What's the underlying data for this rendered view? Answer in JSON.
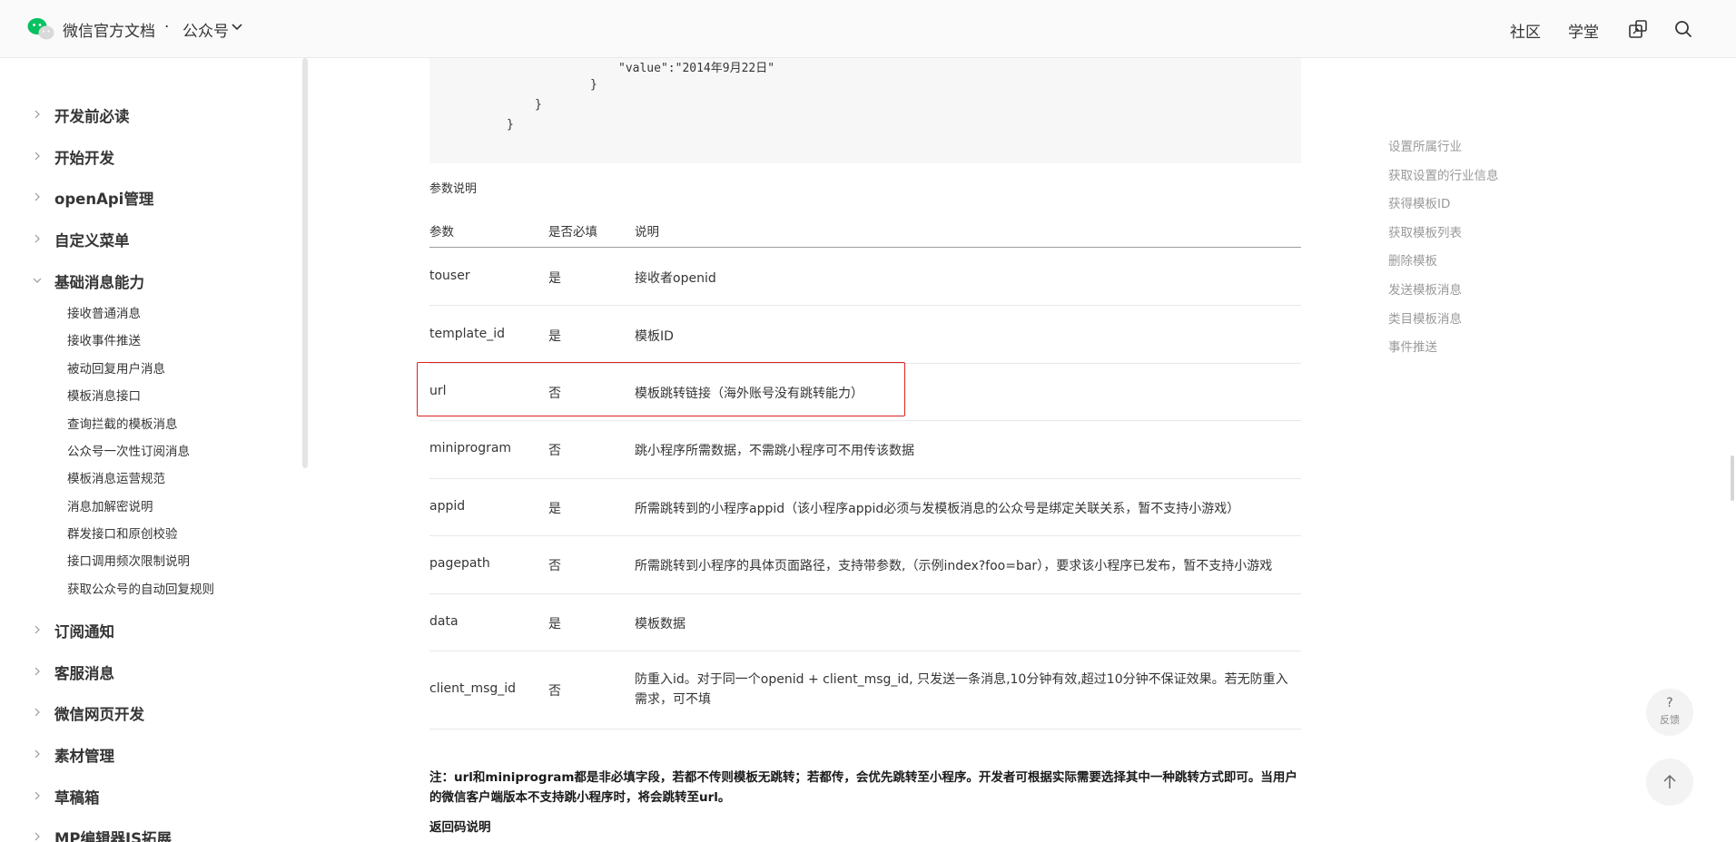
{
  "header": {
    "site_title": "微信官方文档",
    "separator": "·",
    "product": "公众号",
    "nav": [
      "社区",
      "学堂"
    ],
    "icons": {
      "logo": "wechat-logo-icon",
      "switch": "switch-view-icon",
      "search": "search-icon"
    }
  },
  "sidebar": {
    "groups_top": [
      {
        "label": "开发前必读",
        "state": "collapsed"
      },
      {
        "label": "开始开发",
        "state": "collapsed"
      },
      {
        "label": "openApi管理",
        "state": "collapsed"
      },
      {
        "label": "自定义菜单",
        "state": "collapsed"
      },
      {
        "label": "基础消息能力",
        "state": "expanded"
      }
    ],
    "sub_items": [
      "接收普通消息",
      "接收事件推送",
      "被动回复用户消息",
      "模板消息接口",
      "查询拦截的模板消息",
      "公众号一次性订阅消息",
      "模板消息运营规范",
      "消息加解密说明",
      "群发接口和原创校验",
      "接口调用频次限制说明",
      "获取公众号的自动回复规则"
    ],
    "groups_bottom": [
      {
        "label": "订阅通知",
        "state": "collapsed"
      },
      {
        "label": "客服消息",
        "state": "collapsed"
      },
      {
        "label": "微信网页开发",
        "state": "collapsed"
      },
      {
        "label": "素材管理",
        "state": "collapsed"
      },
      {
        "label": "草稿箱",
        "state": "collapsed"
      },
      {
        "label": "MP编辑器JS拓展",
        "state": "collapsed"
      }
    ]
  },
  "main": {
    "code_lines": [
      "\"value\":\"2014年9月22日\"",
      "}",
      "}",
      "}"
    ],
    "params_title": "参数说明",
    "table_headers": [
      "参数",
      "是否必填",
      "说明"
    ],
    "table_rows": [
      {
        "param": "touser",
        "required": "是",
        "desc": "接收者openid"
      },
      {
        "param": "template_id",
        "required": "是",
        "desc": "模板ID"
      },
      {
        "param": "url",
        "required": "否",
        "desc": "模板跳转链接（海外账号没有跳转能力）"
      },
      {
        "param": "miniprogram",
        "required": "否",
        "desc": "跳小程序所需数据，不需跳小程序可不用传该数据"
      },
      {
        "param": "appid",
        "required": "是",
        "desc": "所需跳转到的小程序appid（该小程序appid必须与发模板消息的公众号是绑定关联关系，暂不支持小游戏）"
      },
      {
        "param": "pagepath",
        "required": "否",
        "desc": "所需跳转到小程序的具体页面路径，支持带参数,（示例index?foo=bar），要求该小程序已发布，暂不支持小游戏"
      },
      {
        "param": "data",
        "required": "是",
        "desc": "模板数据"
      },
      {
        "param": "client_msg_id",
        "required": "否",
        "desc": "防重入id。对于同一个openid + client_msg_id, 只发送一条消息,10分钟有效,超过10分钟不保证效果。若无防重入需求，可不填"
      }
    ],
    "note": "注：url和miniprogram都是非必填字段，若都不传则模板无跳转；若都传，会优先跳转至小程序。开发者可根据实际需要选择其中一种跳转方式即可。当用户的微信客户端版本不支持跳小程序时，将会跳转至url。",
    "return_title": "返回码说明"
  },
  "toc": [
    "设置所属行业",
    "获取设置的行业信息",
    "获得模板ID",
    "获取模板列表",
    "删除模板",
    "发送模板消息",
    "类目模板消息",
    "事件推送"
  ],
  "floating": {
    "feedback_symbol": "?",
    "feedback_label": "反馈",
    "top_icon": "arrow-up-icon"
  },
  "colors": {
    "wechat_green": "#07c160",
    "highlight_red": "#e02020",
    "toc_gray": "#9a9a9a"
  }
}
